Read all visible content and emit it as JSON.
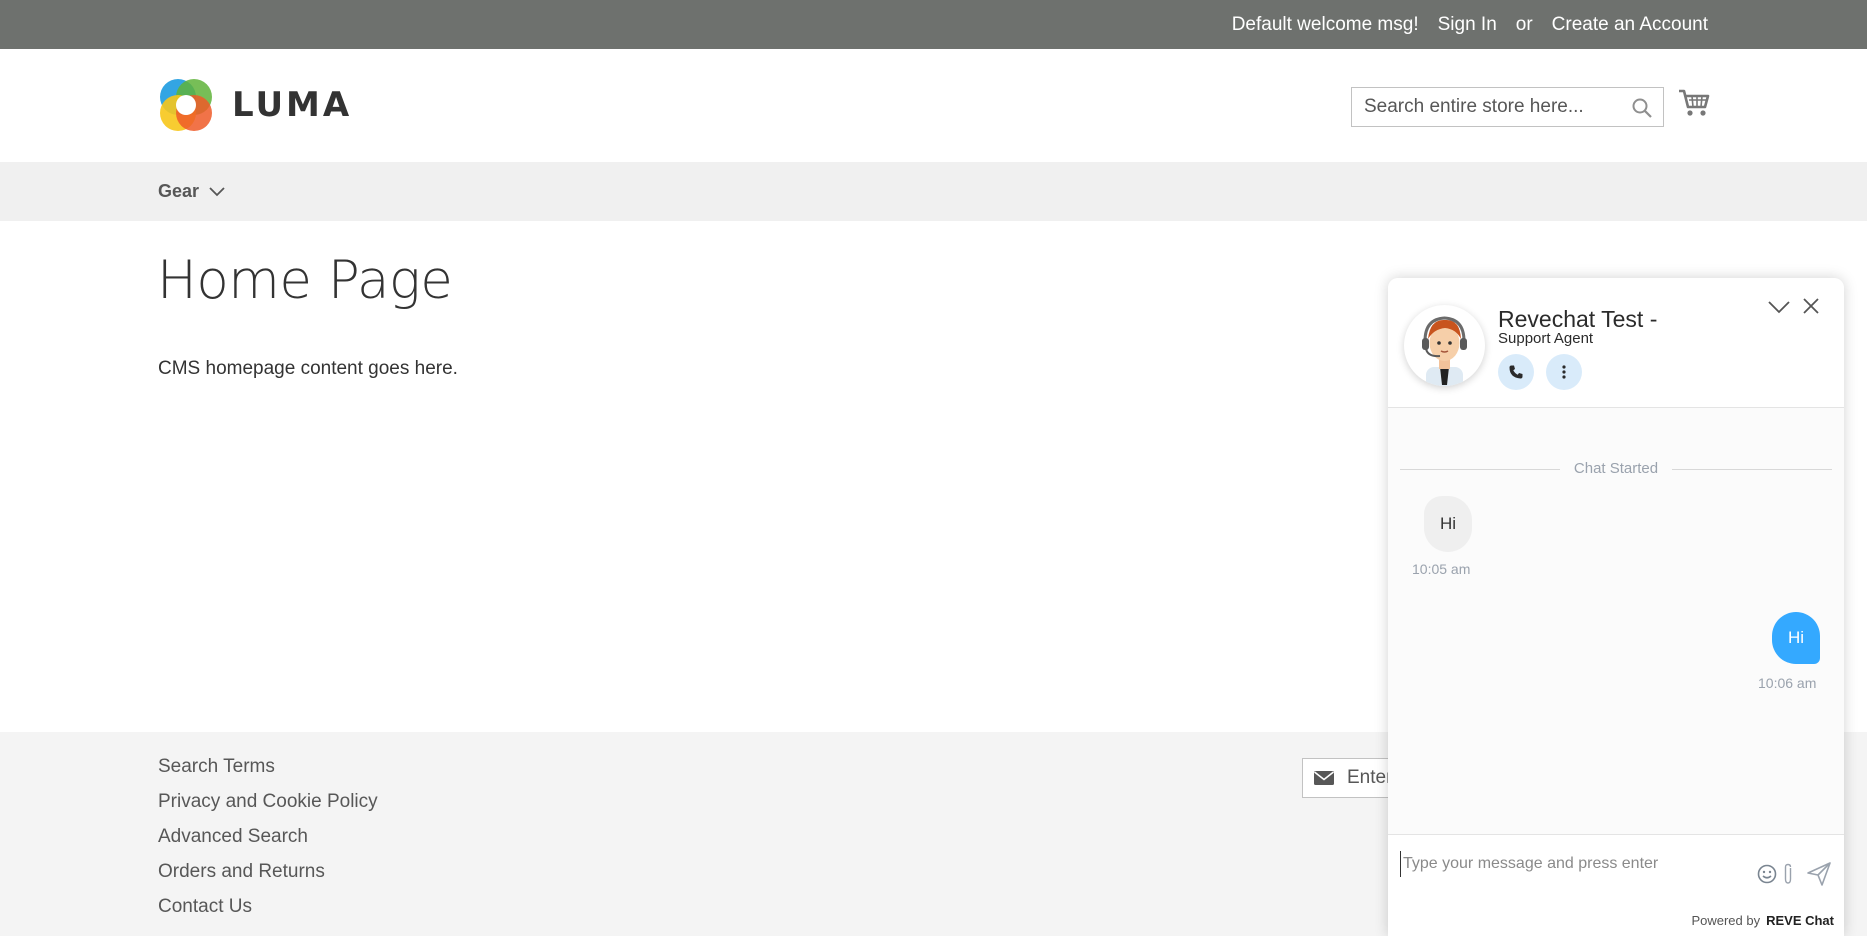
{
  "topbar": {
    "welcome": "Default welcome msg!",
    "sign_in": "Sign In",
    "or": "or",
    "create_account": "Create an Account"
  },
  "header": {
    "logo_text": "LUMA",
    "search_placeholder": "Search entire store here...",
    "search_icon": "search-icon",
    "cart_icon": "cart-icon"
  },
  "nav": {
    "items": [
      {
        "label": "Gear"
      }
    ]
  },
  "main": {
    "title": "Home Page",
    "content": "CMS homepage content goes here."
  },
  "footer": {
    "links": [
      "Search Terms",
      "Privacy and Cookie Policy",
      "Advanced Search",
      "Orders and Returns",
      "Contact Us"
    ],
    "newsletter_placeholder": "Enter"
  },
  "chat": {
    "agent_name": "Revechat Test -",
    "agent_role": "Support Agent",
    "started_label": "Chat Started",
    "messages": [
      {
        "from": "agent",
        "text": "Hi",
        "time": "10:05 am"
      },
      {
        "from": "user",
        "text": "Hi",
        "time": "10:06 am"
      }
    ],
    "input_placeholder": "Type your message and press enter",
    "powered_by": "Powered by",
    "brand": "REVE Chat",
    "accent_color": "#34a9ff"
  },
  "colors": {
    "topbar_bg": "#6e716e",
    "nav_bg": "#f0f0f0",
    "footer_bg": "#f4f4f4"
  }
}
